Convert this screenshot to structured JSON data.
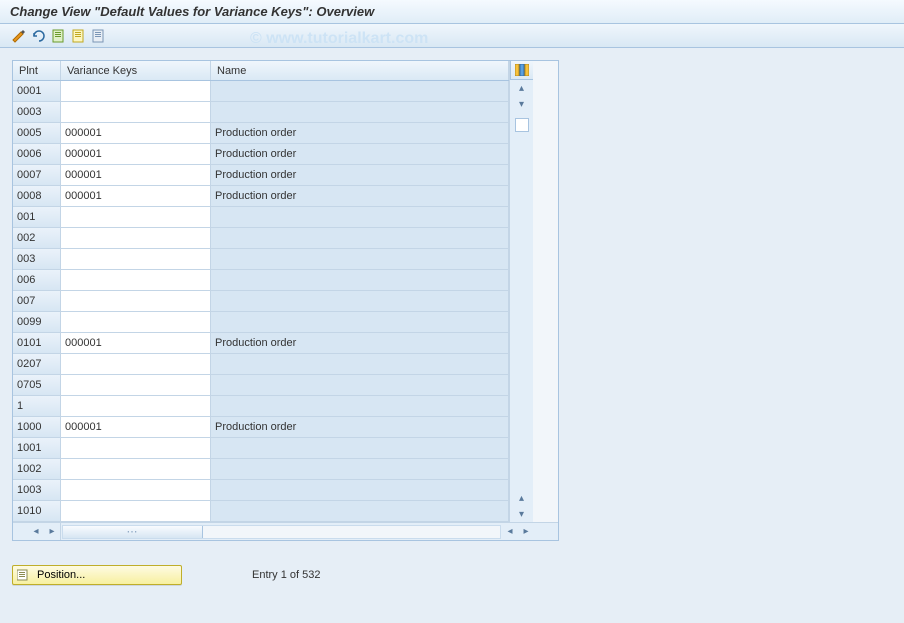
{
  "title": "Change View \"Default Values for Variance Keys\": Overview",
  "watermark": "© www.tutorialkart.com",
  "toolbar": {
    "icons": [
      "toggle",
      "undo",
      "select-all",
      "save-deselect",
      "delimit"
    ]
  },
  "table": {
    "headers": {
      "plnt": "Plnt",
      "vkey": "Variance Keys",
      "name": "Name"
    },
    "rows": [
      {
        "plnt": "0001",
        "vkey": "",
        "name": ""
      },
      {
        "plnt": "0003",
        "vkey": "",
        "name": ""
      },
      {
        "plnt": "0005",
        "vkey": "000001",
        "name": "Production order"
      },
      {
        "plnt": "0006",
        "vkey": "000001",
        "name": "Production order"
      },
      {
        "plnt": "0007",
        "vkey": "000001",
        "name": "Production order"
      },
      {
        "plnt": "0008",
        "vkey": "000001",
        "name": "Production order"
      },
      {
        "plnt": "001",
        "vkey": "",
        "name": ""
      },
      {
        "plnt": "002",
        "vkey": "",
        "name": ""
      },
      {
        "plnt": "003",
        "vkey": "",
        "name": ""
      },
      {
        "plnt": "006",
        "vkey": "",
        "name": ""
      },
      {
        "plnt": "007",
        "vkey": "",
        "name": ""
      },
      {
        "plnt": "0099",
        "vkey": "",
        "name": ""
      },
      {
        "plnt": "0101",
        "vkey": "000001",
        "name": "Production order"
      },
      {
        "plnt": "0207",
        "vkey": "",
        "name": ""
      },
      {
        "plnt": "0705",
        "vkey": "",
        "name": ""
      },
      {
        "plnt": "1",
        "vkey": "",
        "name": ""
      },
      {
        "plnt": "1000",
        "vkey": "000001",
        "name": "Production order"
      },
      {
        "plnt": "1001",
        "vkey": "",
        "name": ""
      },
      {
        "plnt": "1002",
        "vkey": "",
        "name": ""
      },
      {
        "plnt": "1003",
        "vkey": "",
        "name": ""
      },
      {
        "plnt": "1010",
        "vkey": "",
        "name": ""
      }
    ]
  },
  "footer": {
    "position_label": "Position...",
    "entry_text": "Entry 1 of 532"
  }
}
